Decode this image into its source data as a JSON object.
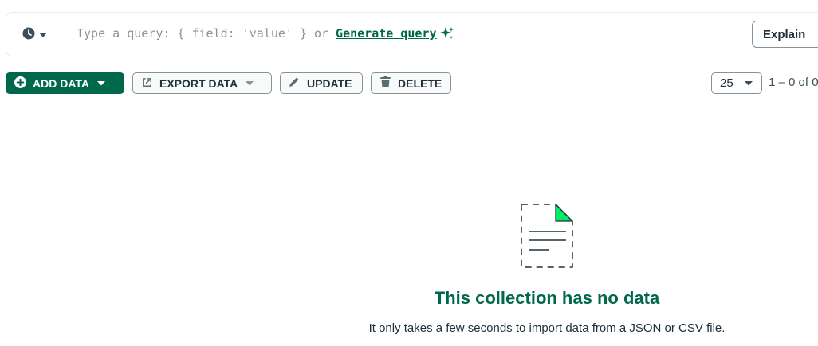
{
  "query_bar": {
    "placeholder": "Type a query: { field: 'value' }",
    "or_text": "or",
    "generate_link": "Generate query",
    "explain_label": "Explain"
  },
  "toolbar": {
    "add_data_label": "ADD DATA",
    "export_data_label": "EXPORT DATA",
    "update_label": "UPDATE",
    "delete_label": "DELETE"
  },
  "pagination": {
    "page_size": "25",
    "range_text": "1 – 0 of 0"
  },
  "empty_state": {
    "title": "This collection has no data",
    "description": "It only takes a few seconds to import data from a JSON or CSV file."
  },
  "icons": {
    "history": "clock-icon",
    "sparkle": "sparkle-icon",
    "add": "plus-circle-icon",
    "export": "export-icon",
    "update": "pencil-icon",
    "delete": "trash-icon",
    "empty": "document-icon"
  },
  "colors": {
    "brand_green": "#00684a",
    "accent_green": "#00ed64",
    "border_gray": "#889397",
    "text_dark": "#21313c"
  }
}
